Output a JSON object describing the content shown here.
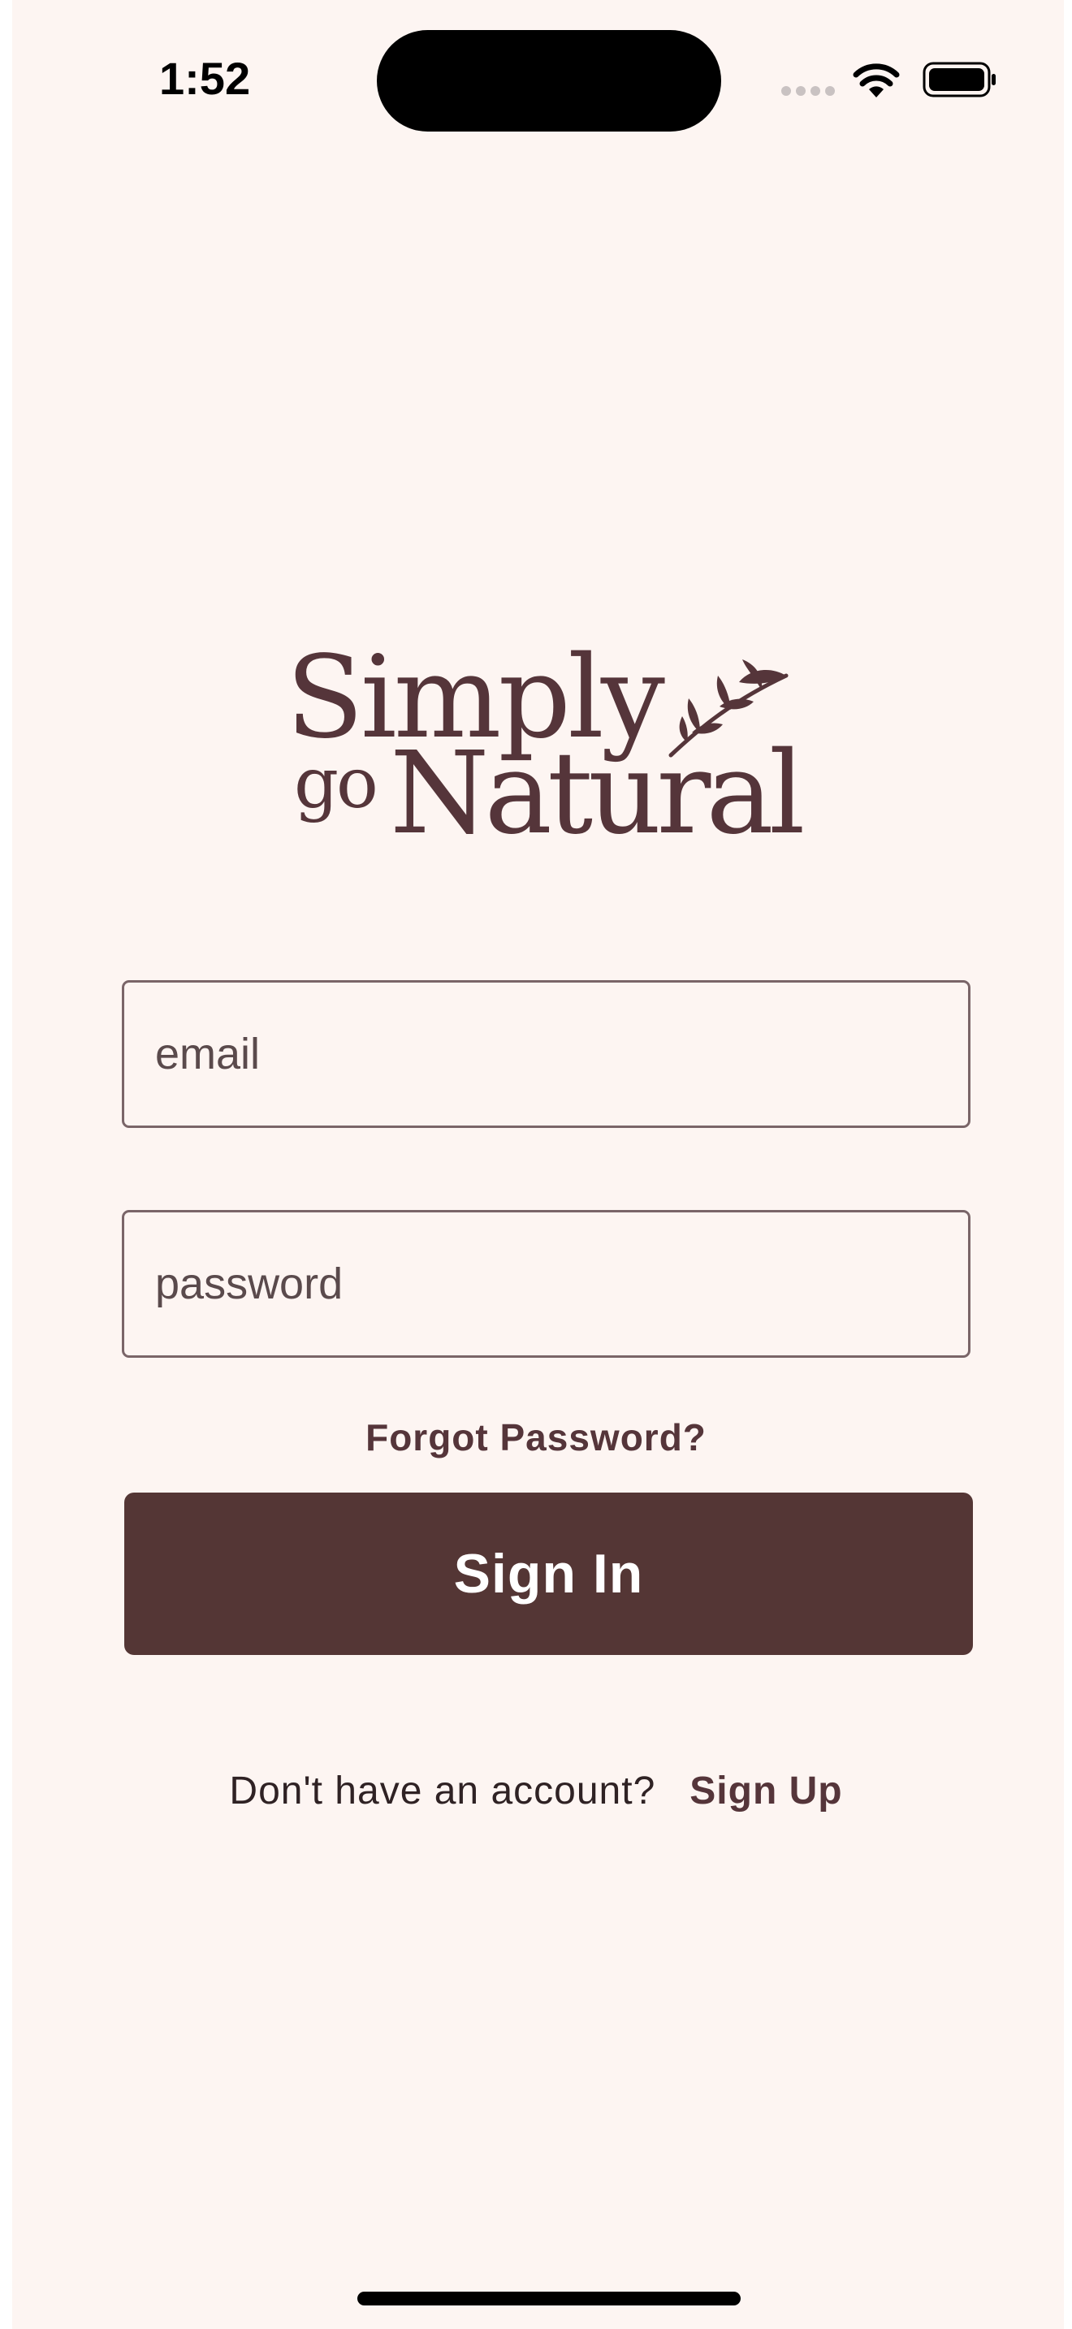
{
  "status_bar": {
    "time": "1:52",
    "icons": [
      "signal-icon",
      "wifi-icon",
      "battery-icon"
    ]
  },
  "logo": {
    "line1": "Simply",
    "prefix": "go",
    "line2": "Natural",
    "icon": "leaf-sprig-icon"
  },
  "form": {
    "email_placeholder": "email",
    "password_placeholder": "password",
    "forgot_password": "Forgot Password?",
    "sign_in": "Sign In"
  },
  "footer": {
    "prompt": "Don't have an account?",
    "sign_up": "Sign Up"
  },
  "colors": {
    "background": "#fdf5f2",
    "brand": "#55353a",
    "button": "#543635",
    "border": "#7a6568"
  }
}
